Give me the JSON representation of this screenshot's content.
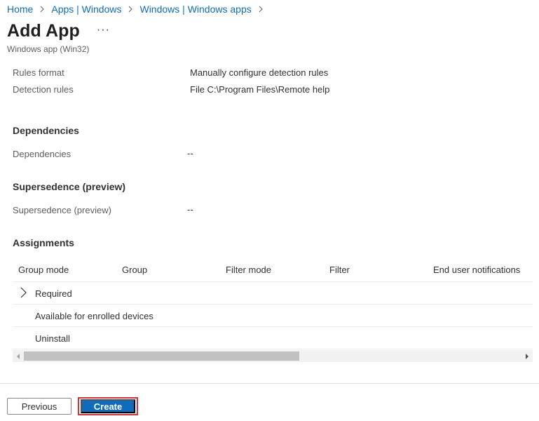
{
  "breadcrumb": {
    "items": [
      "Home",
      "Apps | Windows",
      "Windows | Windows apps"
    ]
  },
  "header": {
    "title": "Add App",
    "more": "···",
    "subtitle": "Windows app (Win32)"
  },
  "detection": {
    "rules_format_label": "Rules format",
    "rules_format_value": "Manually configure detection rules",
    "detection_rules_label": "Detection rules",
    "detection_rules_value": "File C:\\Program Files\\Remote help"
  },
  "dependencies": {
    "heading": "Dependencies",
    "label": "Dependencies",
    "value": "--"
  },
  "supersedence": {
    "heading": "Supersedence (preview)",
    "label": "Supersedence (preview)",
    "value": "--"
  },
  "assignments": {
    "heading": "Assignments",
    "columns": [
      "Group mode",
      "Group",
      "Filter mode",
      "Filter",
      "End user notifications"
    ],
    "rows": [
      "Required",
      "Available for enrolled devices",
      "Uninstall"
    ]
  },
  "footer": {
    "previous_label": "Previous",
    "create_label": "Create"
  },
  "colors": {
    "link": "#0f6cbd",
    "primary": "#0f6cbd",
    "highlight": "#d13438"
  },
  "icons": {
    "separator": "chevron-right-icon",
    "more": "more-icon",
    "expand": "chevron-right-icon"
  }
}
